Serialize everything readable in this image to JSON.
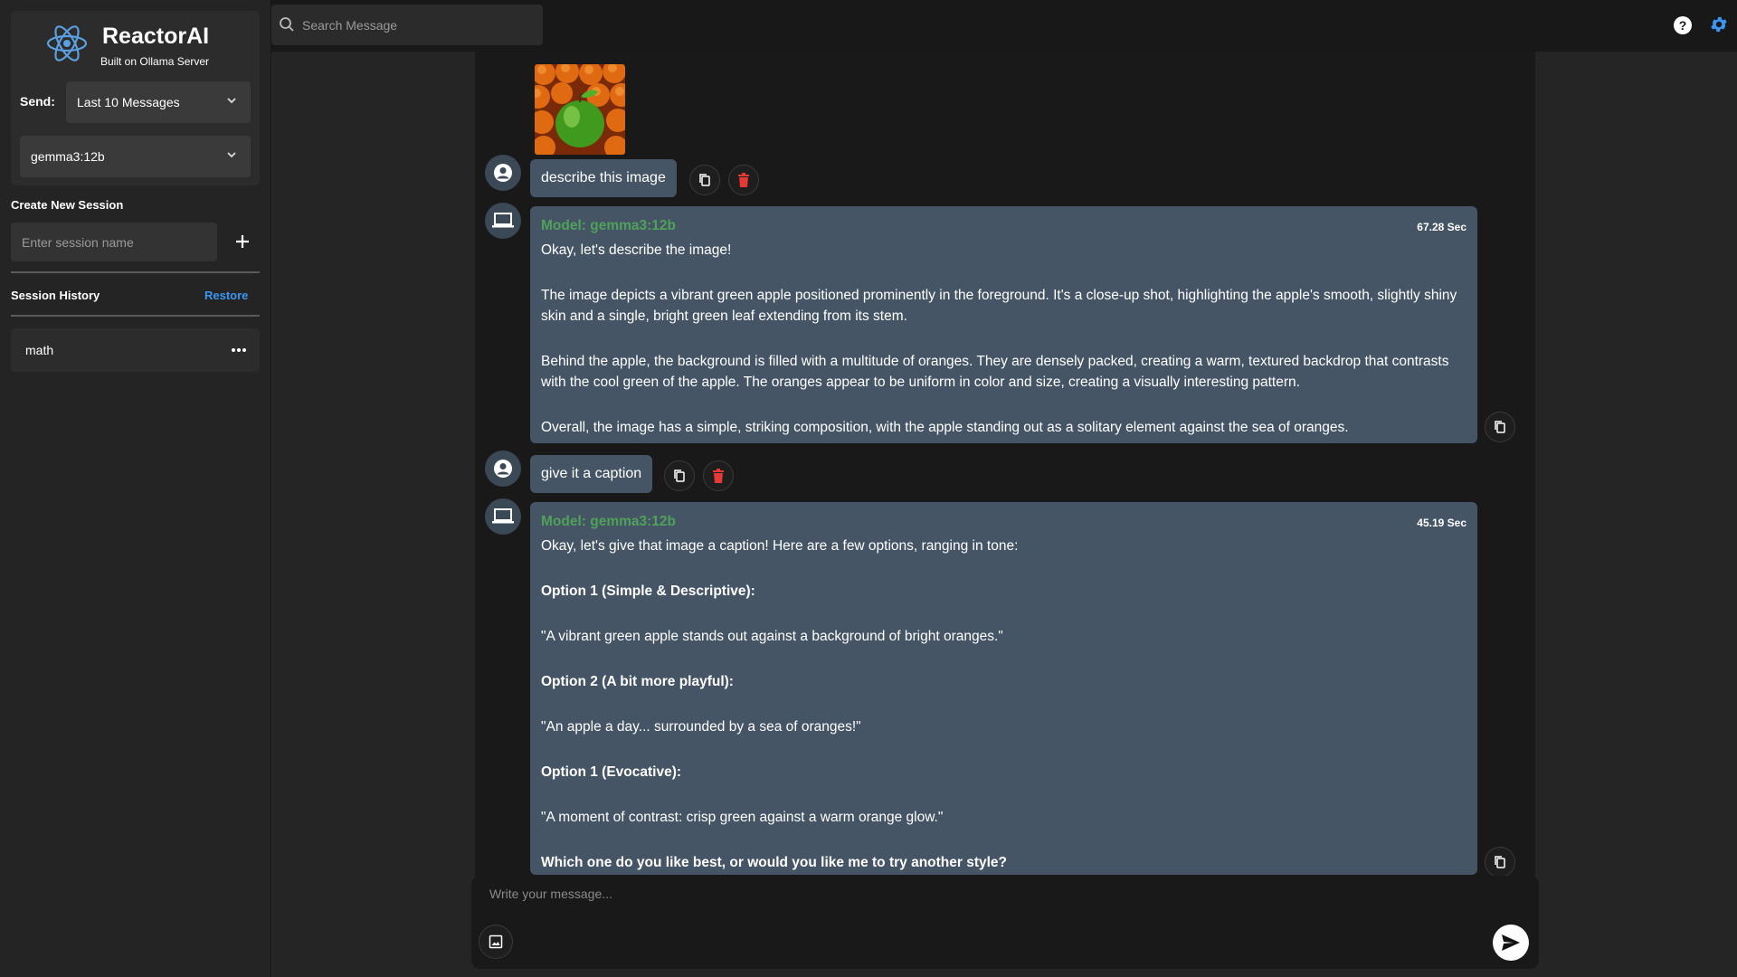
{
  "app": {
    "name": "ReactorAI",
    "subtitle": "Built on Ollama Server"
  },
  "sidebar": {
    "send_label": "Send:",
    "send_value": "Last 10 Messages",
    "model_value": "gemma3:12b",
    "create_title": "Create New Session",
    "session_placeholder": "Enter session name",
    "history_title": "Session History",
    "restore_label": "Restore",
    "sessions": [
      {
        "label": "math"
      }
    ]
  },
  "search": {
    "placeholder": "Search Message"
  },
  "chat": {
    "messages": [
      {
        "role": "user",
        "text": "describe this image",
        "has_image": true
      },
      {
        "role": "model",
        "model_label": "Model: gemma3:12b",
        "time": "67.28 Sec",
        "paragraphs": [
          "Okay, let's describe the image!",
          "The image depicts a vibrant green apple positioned prominently in the foreground. It's a close-up shot, highlighting the apple's smooth, slightly shiny skin and a single, bright green leaf extending from its stem.",
          "Behind the apple, the background is filled with a multitude of oranges. They are densely packed, creating a warm, textured backdrop that contrasts with the cool green of the apple. The oranges appear to be uniform in color and size, creating a visually interesting pattern.",
          "Overall, the image has a simple, striking composition, with the apple standing out as a solitary element against the sea of oranges."
        ]
      },
      {
        "role": "user",
        "text": "give it a caption"
      },
      {
        "role": "model",
        "model_label": "Model: gemma3:12b",
        "time": "45.19 Sec",
        "paragraphs": [
          "Okay, let's give that image a caption! Here are a few options, ranging in tone:",
          "Option 1 (Simple & Descriptive):",
          "\"A vibrant green apple stands out against a background of bright oranges.\"",
          "Option 2 (A bit more playful):",
          "\"An apple a day... surrounded by a sea of oranges!\"",
          "Option 1 (Evocative):",
          "\"A moment of contrast: crisp green against a warm orange glow.\"",
          "Which one do you like best, or would you like me to try another style?"
        ]
      }
    ]
  },
  "composer": {
    "placeholder": "Write your message..."
  },
  "colors": {
    "accent": "#3b95f2",
    "model_name": "#4fa15a",
    "bubble": "#455565",
    "delete": "#e53935"
  },
  "icons": {
    "logo": "atom-icon",
    "search": "search-icon",
    "help": "help-icon",
    "settings": "gear-icon",
    "copy": "copy-icon",
    "delete": "trash-icon",
    "user": "user-avatar-icon",
    "model": "laptop-icon",
    "attach": "image-attach-icon",
    "send": "send-icon"
  }
}
